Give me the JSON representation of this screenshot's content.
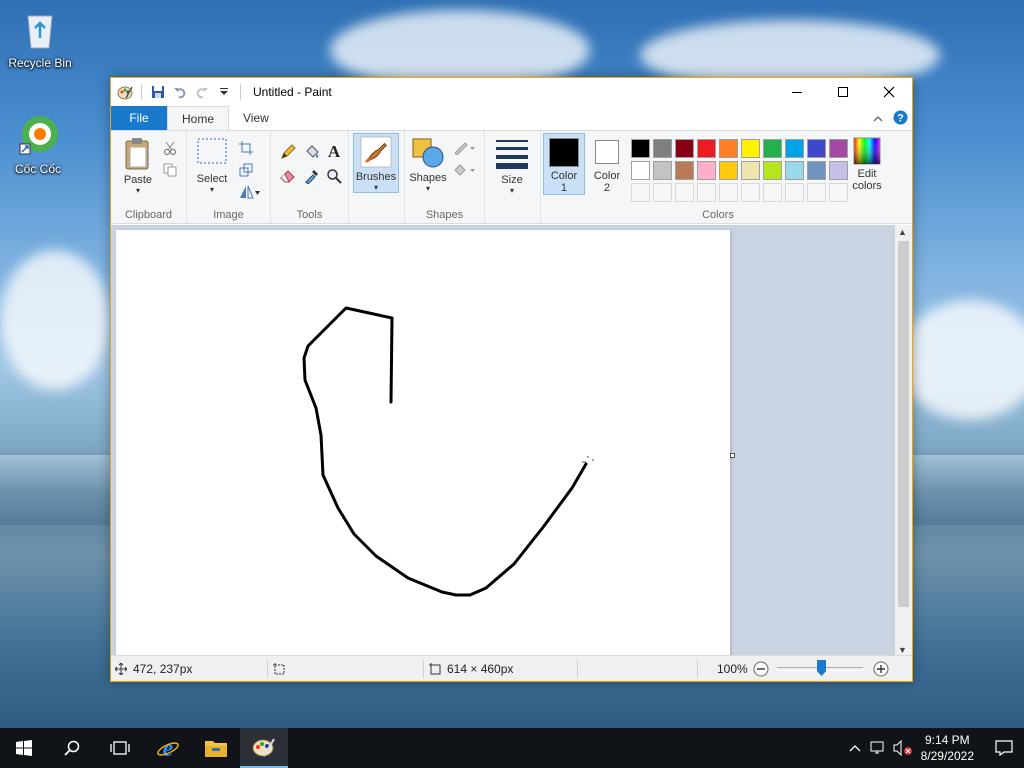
{
  "desktop": {
    "icons": [
      {
        "label": "Recycle Bin"
      },
      {
        "label": "Cốc Cốc"
      }
    ]
  },
  "window": {
    "title": "Untitled - Paint",
    "accent": "#f0a30a"
  },
  "tabs": {
    "file": "File",
    "home": "Home",
    "view": "View"
  },
  "ribbon": {
    "clipboard": {
      "paste": "Paste",
      "label": "Clipboard"
    },
    "image": {
      "select": "Select",
      "label": "Image"
    },
    "tools": {
      "label": "Tools",
      "text_tool": "A"
    },
    "brushes": {
      "label": "Brushes"
    },
    "shapes": {
      "shapes_btn": "Shapes",
      "label": "Shapes"
    },
    "size": {
      "label": "Size"
    },
    "colors": {
      "color1_line1": "Color",
      "color1_line2": "1",
      "color2_line1": "Color",
      "color2_line2": "2",
      "edit_line1": "Edit",
      "edit_line2": "colors",
      "label": "Colors",
      "color1": "#000000",
      "color2": "#ffffff",
      "row1": [
        "#000000",
        "#7f7f7f",
        "#880015",
        "#ed1c24",
        "#ff7f27",
        "#fff200",
        "#22b14c",
        "#00a2e8",
        "#3f48cc",
        "#a349a4"
      ],
      "row2": [
        "#ffffff",
        "#c3c3c3",
        "#b97a57",
        "#ffaec9",
        "#ffc90e",
        "#efe4b0",
        "#b5e61d",
        "#99d9ea",
        "#7092be",
        "#c8bfe7"
      ]
    }
  },
  "status": {
    "position": "472, 237px",
    "size": "614 × 460px",
    "zoom": "100%"
  },
  "taskbar": {
    "time": "9:14 PM",
    "date": "8/29/2022"
  }
}
